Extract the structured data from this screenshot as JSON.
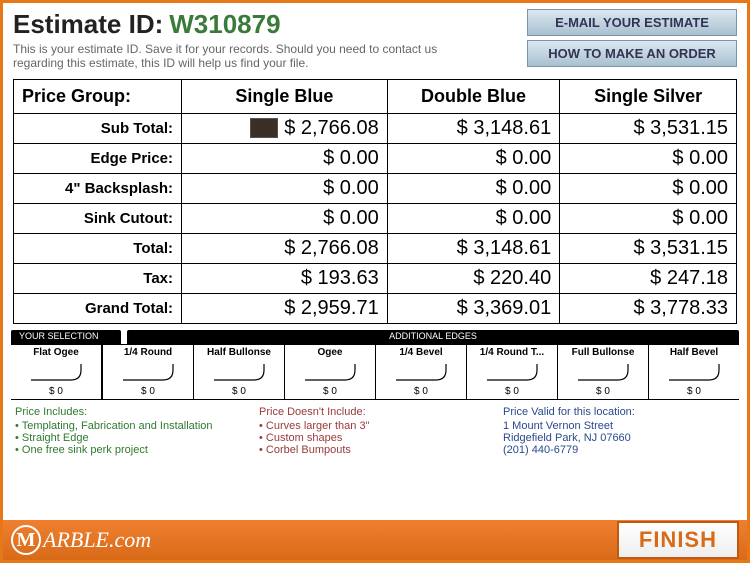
{
  "header": {
    "label": "Estimate ID:",
    "id": "W310879",
    "sub": "This is your estimate ID. Save it for your records. Should you need to contact us regarding this estimate, this ID will help us find your file.",
    "btn_email": "E-MAIL YOUR ESTIMATE",
    "btn_order": "HOW TO MAKE AN ORDER"
  },
  "table": {
    "head_label": "Price Group:",
    "cols": [
      "Single Blue",
      "Double Blue",
      "Single Silver"
    ],
    "rows": [
      {
        "label": "Sub Total:",
        "vals": [
          "$ 2,766.08",
          "$ 3,148.61",
          "$ 3,531.15"
        ],
        "swatch": true
      },
      {
        "label": "Edge Price:",
        "vals": [
          "$ 0.00",
          "$ 0.00",
          "$ 0.00"
        ]
      },
      {
        "label": "4\" Backsplash:",
        "vals": [
          "$ 0.00",
          "$ 0.00",
          "$ 0.00"
        ]
      },
      {
        "label": "Sink Cutout:",
        "vals": [
          "$ 0.00",
          "$ 0.00",
          "$ 0.00"
        ]
      },
      {
        "label": "Total:",
        "vals": [
          "$ 2,766.08",
          "$ 3,148.61",
          "$ 3,531.15"
        ]
      },
      {
        "label": "Tax:",
        "vals": [
          "$ 193.63",
          "$ 220.40",
          "$ 247.18"
        ]
      },
      {
        "label": "Grand Total:",
        "vals": [
          "$ 2,959.71",
          "$ 3,369.01",
          "$ 3,778.33"
        ]
      }
    ]
  },
  "edges": {
    "sel_head": "YOUR SELECTION",
    "add_head": "ADDITIONAL EDGES",
    "items": [
      {
        "name": "Flat Ogee",
        "price": "$ 0",
        "sel": true
      },
      {
        "name": "1/4 Round",
        "price": "$ 0"
      },
      {
        "name": "Half Bullonse",
        "price": "$ 0"
      },
      {
        "name": "Ogee",
        "price": "$ 0"
      },
      {
        "name": "1/4 Bevel",
        "price": "$ 0"
      },
      {
        "name": "1/4 Round T...",
        "price": "$ 0"
      },
      {
        "name": "Full Bullonse",
        "price": "$ 0"
      },
      {
        "name": "Half Bevel",
        "price": "$ 0"
      }
    ]
  },
  "info": {
    "includes": {
      "title": "Price Includes:",
      "items": [
        "Templating, Fabrication and Installation",
        "Straight Edge",
        "One free sink perk project"
      ]
    },
    "excludes": {
      "title": "Price Doesn't Include:",
      "items": [
        "Curves larger than 3\"",
        "Custom shapes",
        "Corbel Bumpouts"
      ]
    },
    "location": {
      "title": "Price Valid for this location:",
      "lines": [
        "1 Mount Vernon Street",
        "Ridgefield Park, NJ 07660",
        "(201) 440-6779"
      ]
    }
  },
  "footer": {
    "logo_text": "ARBLE.com",
    "finish": "FINISH"
  }
}
